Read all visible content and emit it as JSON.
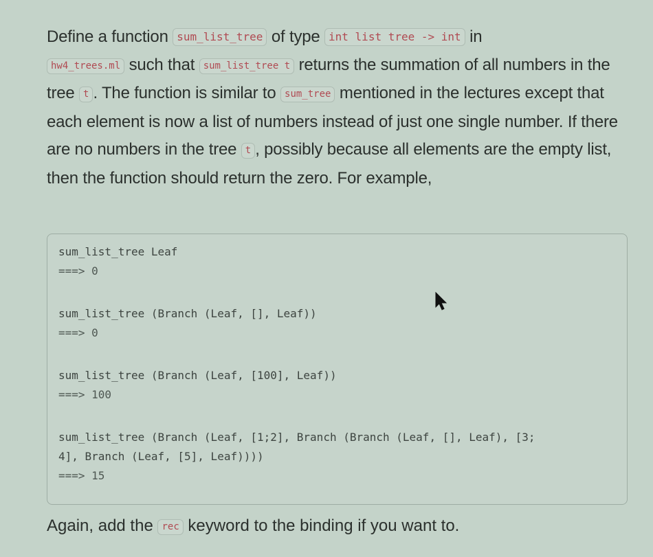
{
  "description": {
    "p1_before_fn": "Define a function ",
    "fn_name": "sum_list_tree",
    "p1_of_type": " of type ",
    "fn_type": "int list tree -> int",
    "p1_in": " in",
    "filename": "hw4_trees.ml",
    "p1_such_that": " such that ",
    "call_expr": "sum_list_tree t",
    "p1_returns": " returns the summation of all numbers in the tree ",
    "var_t": "t",
    "p1_similar": ". The function is similar to ",
    "ref_fn": "sum_tree",
    "p1_rest": " mentioned in the lectures except that each element is now a list of numbers instead of just one single number. If there are no numbers in the tree ",
    "var_t2": "t",
    "p1_end": ", possibly because all elements are the empty list, then the function should return the zero. For example,"
  },
  "examples": [
    {
      "lines": [
        "sum_list_tree Leaf"
      ],
      "result": "===> 0"
    },
    {
      "lines": [
        "sum_list_tree (Branch (Leaf, [], Leaf))"
      ],
      "result": "===> 0"
    },
    {
      "lines": [
        "sum_list_tree (Branch (Leaf, [100], Leaf))"
      ],
      "result": "===> 100"
    },
    {
      "lines": [
        "sum_list_tree (Branch (Leaf, [1;2], Branch (Branch (Leaf, [], Leaf), [3;",
        "4], Branch (Leaf, [5], Leaf))))"
      ],
      "result": "===> 15"
    }
  ],
  "footer": {
    "before": "Again, add the ",
    "keyword": "rec",
    "after": " keyword to the binding if you want to."
  },
  "colors": {
    "background": "#c4d3c9",
    "inline_code_text": "#b04a52",
    "body_text": "#2b302d"
  }
}
